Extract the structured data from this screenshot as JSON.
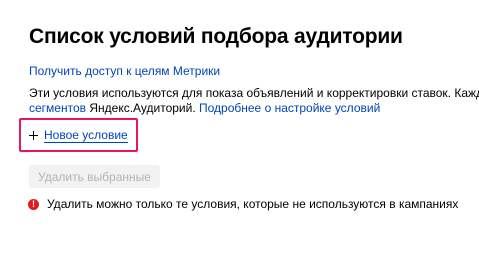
{
  "header": {
    "title": "Список условий подбора аудитории"
  },
  "metrika_link": "Получить доступ к целям Метрики",
  "description": {
    "line1": "Эти условия используются для показа объявлений и корректировки ставок. Каждое",
    "segments_link": "сегментов",
    "mid_text": " Яндекс.Аудиторий. ",
    "settings_link": "Подробнее о настройке условий"
  },
  "actions": {
    "new_condition": "Новое условие",
    "delete_selected": "Удалить выбранные"
  },
  "warning": {
    "icon": "!",
    "text": "Удалить можно только те условия, которые не используются в кампаниях"
  },
  "colors": {
    "link": "#0044bb",
    "highlight_border": "#e8175d",
    "warning_icon": "#e21c1c",
    "disabled_button_bg": "#f2f2f2",
    "disabled_button_text": "#b3b3b3"
  }
}
